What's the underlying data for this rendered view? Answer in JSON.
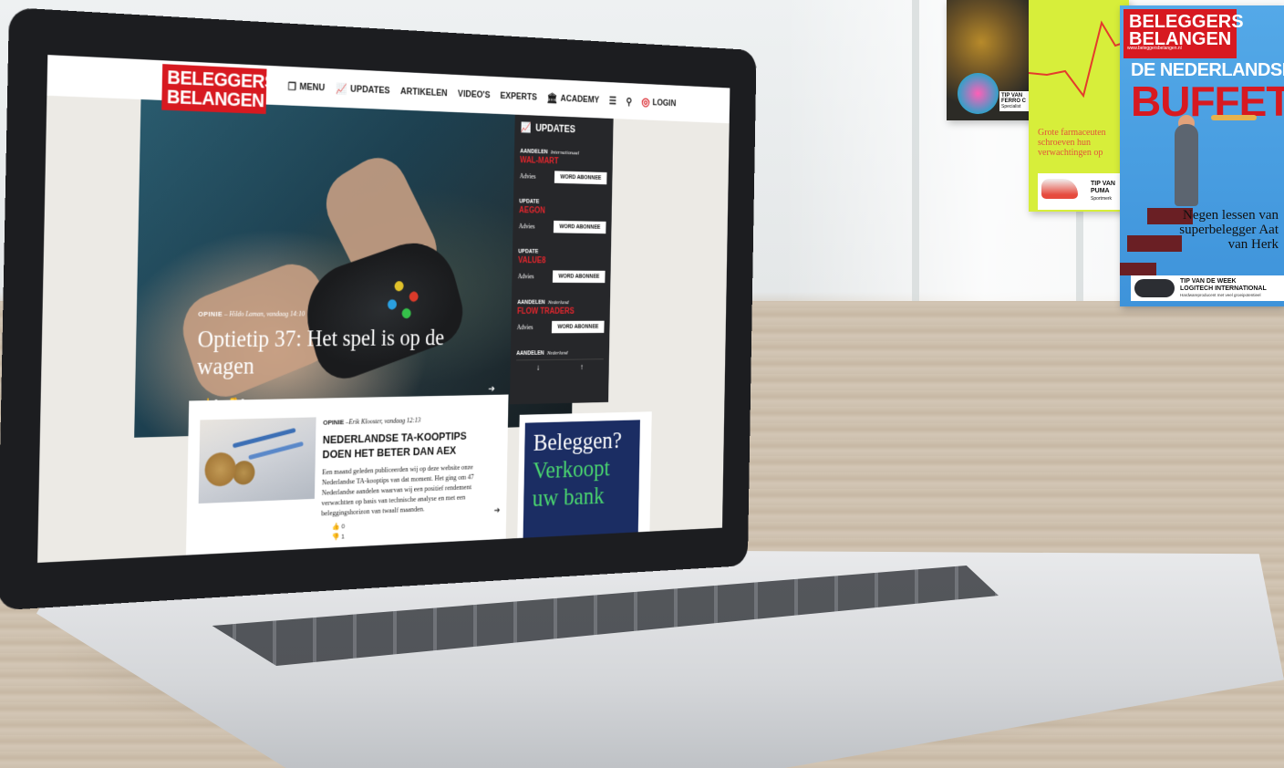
{
  "brand": {
    "line1": "BELEGGERS",
    "line2": "BELANGEN",
    "color": "#d71920"
  },
  "nav": {
    "items": [
      {
        "label": "MENU",
        "icon": "menu-copy-icon"
      },
      {
        "label": "UPDATES",
        "icon": "chart-line-icon"
      },
      {
        "label": "ARTIKELEN"
      },
      {
        "label": "VIDEO'S"
      },
      {
        "label": "EXPERTS"
      },
      {
        "label": "ACADEMY",
        "icon": "academy-icon"
      }
    ],
    "login_label": "LOGIN"
  },
  "hero": {
    "category": "OPINIE",
    "byline": "– Hildo Laman, vandaag 14:10",
    "title": "Optietip 37: Het spel is op de wagen",
    "likes": "0",
    "dislikes": "0"
  },
  "updates": {
    "title": "UPDATES",
    "items": [
      {
        "category": "AANDELEN",
        "region": "Internationaal",
        "name": "WAL-MART",
        "label": "Advies",
        "button": "WORD ABONNEE"
      },
      {
        "category": "UPDATE",
        "region": "",
        "name": "AEGON",
        "label": "Advies",
        "button": "WORD ABONNEE"
      },
      {
        "category": "UPDATE",
        "region": "",
        "name": "VALUE8",
        "label": "Advies",
        "button": "WORD ABONNEE"
      },
      {
        "category": "AANDELEN",
        "region": "Nederland",
        "name": "FLOW TRADERS",
        "label": "Advies",
        "button": "WORD ABONNEE"
      },
      {
        "category": "AANDELEN",
        "region": "Nederland",
        "name": "",
        "label": "",
        "button": ""
      }
    ],
    "arrow_down": "↓",
    "arrow_up": "↑",
    "accent": "#e3262d"
  },
  "article": {
    "category": "OPINIE",
    "byline": "–Erik Klooster, vandaag 12:13",
    "title": "NEDERLANDSE TA-KOOPTIPS DOEN HET BETER DAN AEX",
    "excerpt": "Een maand geleden publiceerden wij op deze website onze Nederlandse TA-kooptips van dat moment. Het ging om 47 Nederlandse aandelen waarvan wij een positief rendement verwachtten op basis van technische analyse en met een beleggingshorizon van twaalf maanden.",
    "likes": "0",
    "dislikes": "1"
  },
  "ad": {
    "line1": "Beleggen?",
    "line2": "Verkoopt",
    "line3": "uw bank",
    "bg": "#1b2d63",
    "accent": "#4ad56f"
  },
  "magazines": {
    "mag1": {
      "tip": "TIP VAN FERRO C",
      "sub": "Specialist"
    },
    "mag2": {
      "pharma": "Grote farmaceuten schroeven hun verwachtingen op",
      "tip1": "TIP VAN",
      "tip2": "PUMA",
      "tip3": "Sportmerk"
    },
    "mag3": {
      "logo1": "BELEGGERS",
      "logo2": "BELANGEN",
      "url": "www.beleggersbelangen.nl",
      "title1": "DE NEDERLANDSE",
      "title2": "BUFFETT",
      "subtitle": "Negen lessen van superbelegger Aat van Herk",
      "tip1": "TIP VAN DE WEEK",
      "tip2": "LOGITECH INTERNATIONAL",
      "tip3": "Hardwareproducent met veel groeipotentieel"
    }
  }
}
